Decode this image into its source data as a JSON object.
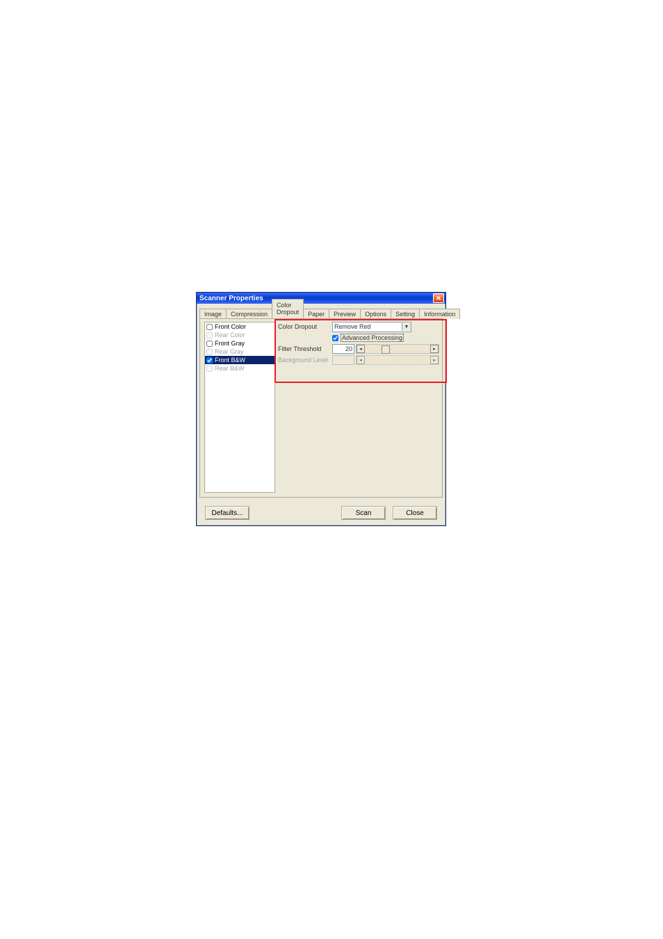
{
  "window": {
    "title": "Scanner Properties"
  },
  "tabs": [
    {
      "label": "Image"
    },
    {
      "label": "Compression"
    },
    {
      "label": "Color Dropout"
    },
    {
      "label": "Paper"
    },
    {
      "label": "Preview"
    },
    {
      "label": "Options"
    },
    {
      "label": "Setting"
    },
    {
      "label": "Information"
    }
  ],
  "active_tab": 2,
  "sidepanel": {
    "items": [
      {
        "label": "Front Color",
        "checked": false,
        "disabled": false
      },
      {
        "label": "Rear Color",
        "checked": false,
        "disabled": true
      },
      {
        "label": "Front Gray",
        "checked": false,
        "disabled": false
      },
      {
        "label": "Rear Gray",
        "checked": false,
        "disabled": true
      },
      {
        "label": "Front B&W",
        "checked": true,
        "disabled": false,
        "selected": true
      },
      {
        "label": "Rear B&W",
        "checked": false,
        "disabled": true
      }
    ]
  },
  "main": {
    "color_dropout_label": "Color Dropout",
    "color_dropout_value": "Remove Red",
    "advanced_processing_label": "Advanced Processing",
    "advanced_processing_checked": true,
    "filter_threshold_label": "Filter Threshold",
    "filter_threshold_value": "20",
    "background_level_label": "Background Level",
    "background_level_value": ""
  },
  "buttons": {
    "defaults": "Defaults...",
    "scan": "Scan",
    "close": "Close"
  }
}
